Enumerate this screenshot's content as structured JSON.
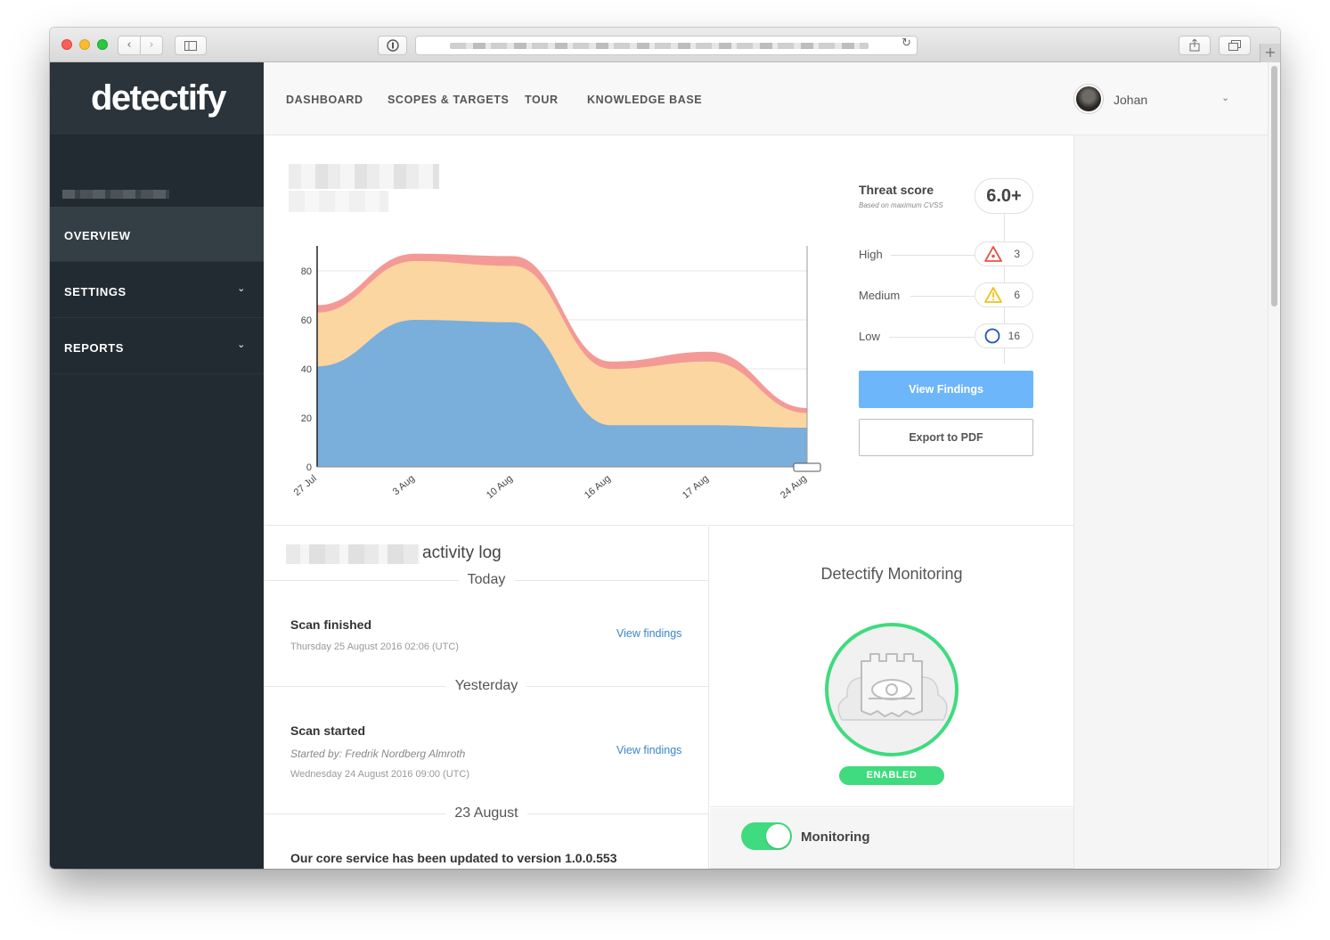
{
  "browser": {
    "reload_icon": "reload-icon"
  },
  "app": {
    "logo": "detectify"
  },
  "sidebar": {
    "items": [
      {
        "label": "OVERVIEW"
      },
      {
        "label": "SETTINGS"
      },
      {
        "label": "REPORTS"
      }
    ]
  },
  "header": {
    "nav": [
      "DASHBOARD",
      "SCOPES & TARGETS",
      "TOUR",
      "KNOWLEDGE BASE"
    ],
    "user": "Johan"
  },
  "threat": {
    "label": "Threat score",
    "sub": "Based on maximum CVSS",
    "score": "6.0+",
    "levels": [
      {
        "name": "High",
        "count": "3",
        "color": "#e9524a"
      },
      {
        "name": "Medium",
        "count": "6",
        "color": "#f2c01c"
      },
      {
        "name": "Low",
        "count": "16",
        "color": "#1f5aa6"
      }
    ]
  },
  "buttons": {
    "view_findings": "View Findings",
    "export_pdf": "Export to PDF"
  },
  "chart_data": {
    "type": "area",
    "categories": [
      "27 Jul",
      "3 Aug",
      "10 Aug",
      "16 Aug",
      "17 Aug",
      "24 Aug"
    ],
    "yticks": [
      0,
      20,
      40,
      60,
      80
    ],
    "ylim": [
      0,
      88
    ],
    "stacked": true,
    "series": [
      {
        "values": [
          41,
          60,
          59,
          17,
          17,
          16
        ],
        "color": "#7aaedb"
      },
      {
        "values": [
          22,
          24,
          23,
          23,
          26,
          6
        ],
        "color": "#fcd6a0"
      },
      {
        "values": [
          3,
          3,
          4,
          3,
          4,
          2
        ],
        "color": "#f39a97"
      }
    ]
  },
  "activity": {
    "title": "activity log",
    "sections": [
      {
        "label": "Today"
      },
      {
        "label": "Yesterday"
      },
      {
        "label": "23 August"
      }
    ],
    "events": [
      {
        "title": "Scan finished",
        "time": "Thursday 25 August 2016 02:06 (UTC)",
        "link": "View findings"
      },
      {
        "title": "Scan started",
        "by": "Started by: Fredrik Nordberg Almroth",
        "time": "Wednesday 24 August 2016 09:00 (UTC)",
        "link": "View findings"
      },
      {
        "title": "Our core service has been updated to version 1.0.0.553"
      }
    ]
  },
  "monitoring": {
    "title": "Detectify Monitoring",
    "status": "ENABLED",
    "toggle_label": "Monitoring",
    "toggle_on": true
  }
}
